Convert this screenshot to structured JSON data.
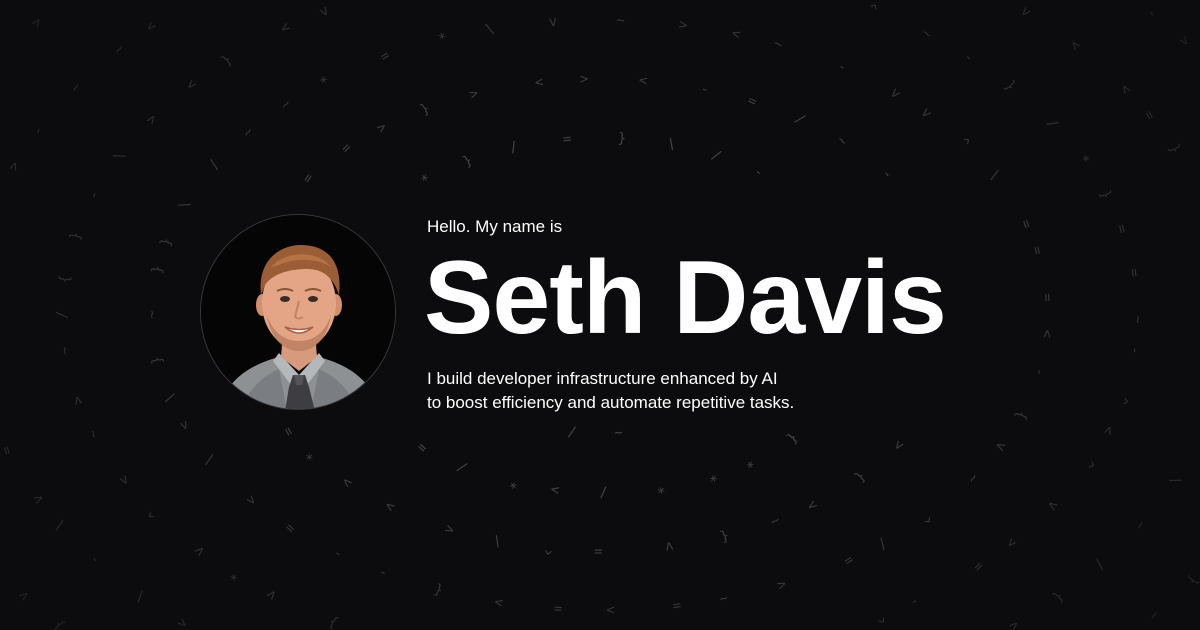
{
  "colors": {
    "background": "#0c0b0d",
    "text": "#ffffff",
    "pattern": "#58585c"
  },
  "intro": {
    "greeting": "Hello. My name is",
    "name": "Seth Davis",
    "tagline_line1": "I build developer infrastructure enhanced by AI",
    "tagline_line2": "to boost efficiency and automate repetitive tasks."
  },
  "photo": {
    "icon": "portrait-photo"
  },
  "pattern": {
    "glyphs": [
      "v",
      "^",
      "=",
      "*",
      "{",
      "}",
      "/",
      "\\",
      "-",
      "~",
      ">",
      "<"
    ]
  }
}
